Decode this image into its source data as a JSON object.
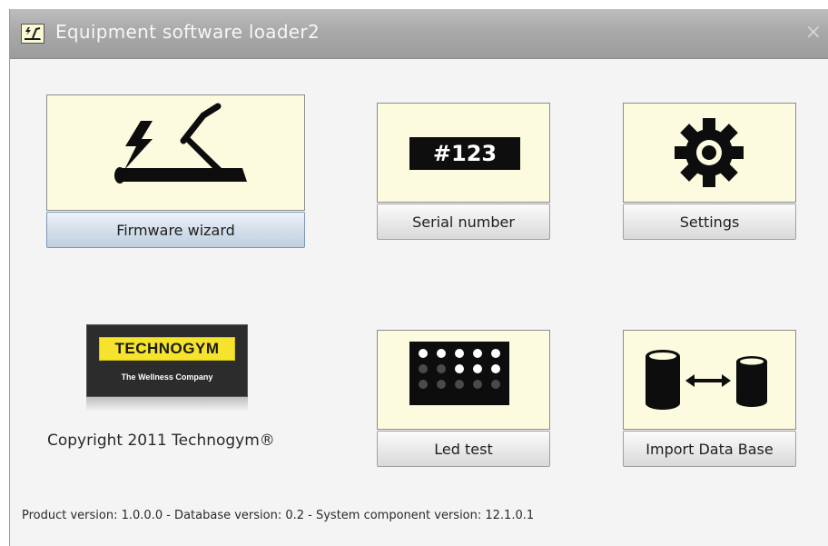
{
  "window": {
    "title": "Equipment software loader2",
    "close_glyph": "×",
    "app_icon": "treadmill-app-icon"
  },
  "buttons": {
    "firmware": "Firmware wizard",
    "serial": "Serial number",
    "settings": "Settings",
    "led": "Led test",
    "import": "Import Data Base"
  },
  "serial_display": "#123",
  "logo": {
    "name": "TECHNOGYM",
    "tagline": "The Wellness Company"
  },
  "copyright": "Copyright 2011 Technogym®",
  "footer": "Product version: 1.0.0.0 - Database version: 0.2 - System component version: 12.1.0.1",
  "colors": {
    "tile_bg": "#fcfbdf",
    "active_button": "#d4dfeb",
    "logo_yellow": "#f5e32c"
  }
}
